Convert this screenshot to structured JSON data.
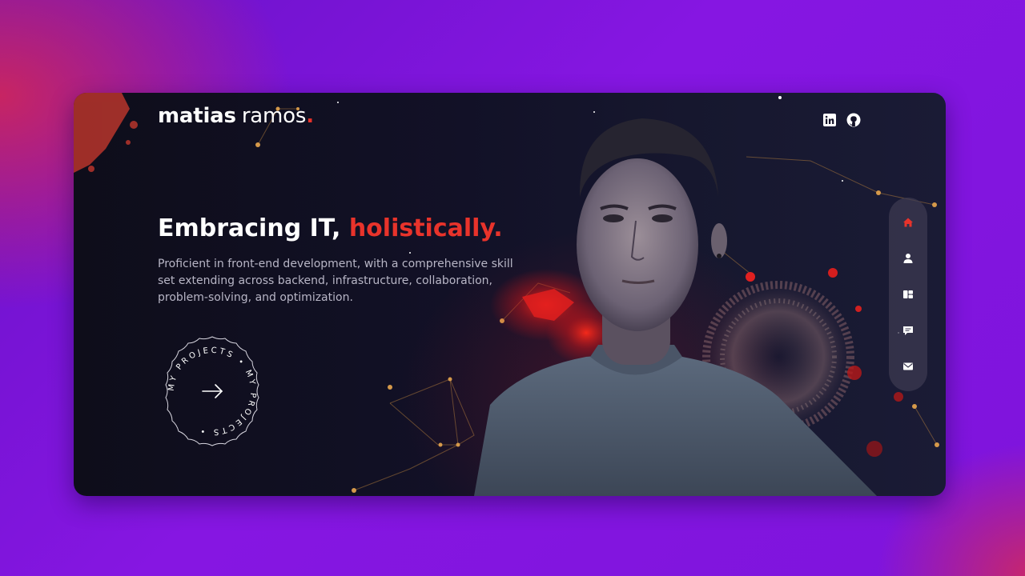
{
  "brand": {
    "first": "matias",
    "last": "ramos",
    "dot": "."
  },
  "social": [
    {
      "name": "linkedin-icon"
    },
    {
      "name": "github-icon"
    }
  ],
  "hero": {
    "title_main": "Embracing IT, ",
    "title_accent": "holistically.",
    "description": "Proficient in front-end development, with a comprehensive skill set extending across backend, infrastructure, collaboration, problem-solving, and optimization.",
    "cta_ring_text": "MY PROJECTS • MY PROJECTS •"
  },
  "nav": [
    {
      "icon": "home-icon",
      "active": true
    },
    {
      "icon": "user-icon",
      "active": false
    },
    {
      "icon": "projects-icon",
      "active": false
    },
    {
      "icon": "chat-icon",
      "active": false
    },
    {
      "icon": "mail-icon",
      "active": false
    }
  ],
  "colors": {
    "accent": "#e8332b",
    "card_bg": "#121127",
    "text_primary": "#ffffff",
    "text_secondary": "#b8b6c6"
  }
}
